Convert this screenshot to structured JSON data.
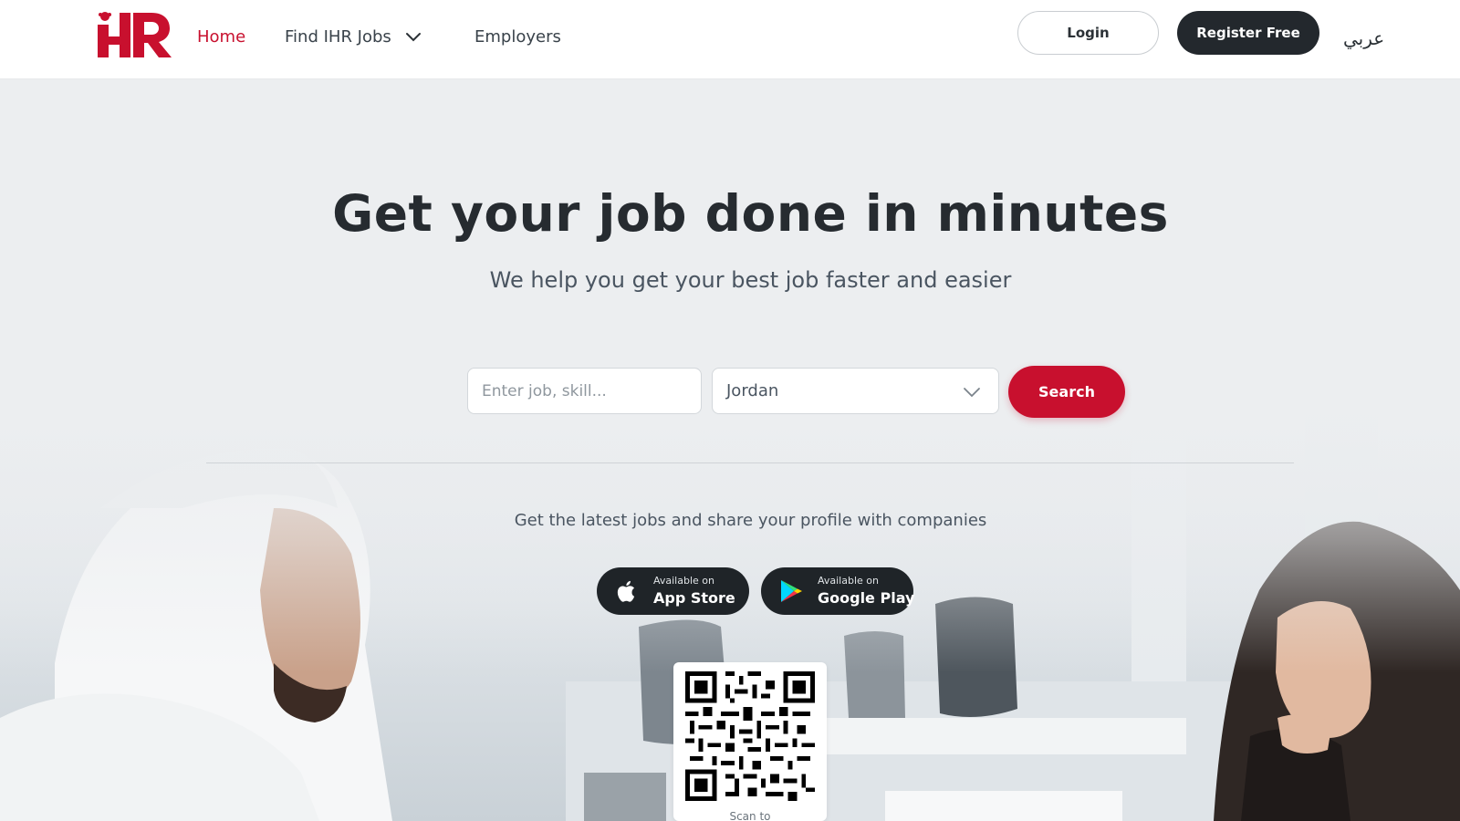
{
  "header": {
    "logo_text": "iHR",
    "nav": {
      "home": "Home",
      "find_jobs": "Find IHR Jobs",
      "employers": "Employers"
    },
    "login_label": "Login",
    "register_label": "Register Free",
    "language_label": "عربي"
  },
  "hero": {
    "title": "Get your job done in minutes",
    "subtitle": "We help you get your best job faster and easier",
    "search": {
      "placeholder": "Enter job, skill...",
      "country_value": "Jordan",
      "button_label": "Search"
    },
    "promo_text": "Get the latest jobs and share your profile with companies",
    "app_store": {
      "small": "Available on",
      "big": "App Store"
    },
    "google_play": {
      "small": "Available on",
      "big": "Google Play"
    },
    "qr_caption": "Scan to"
  },
  "colors": {
    "brand_red": "#c8102e",
    "dark": "#23282d"
  }
}
